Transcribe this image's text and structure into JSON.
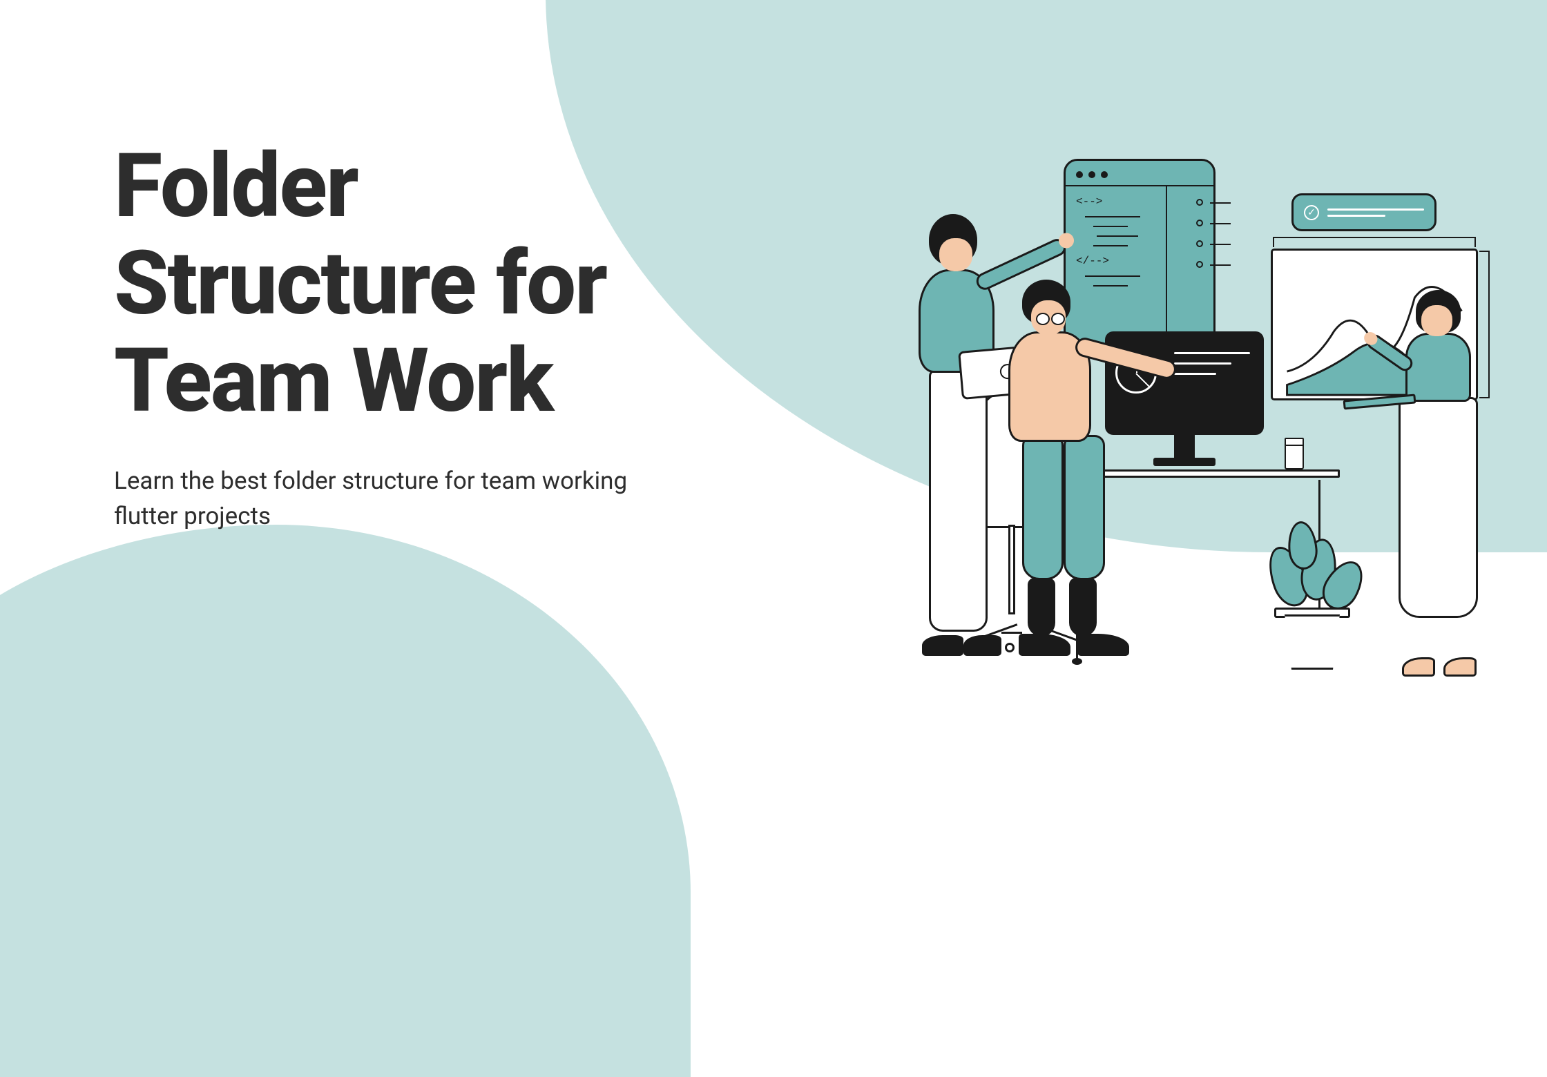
{
  "title": "Folder Structure for Team Work",
  "subtitle": "Learn the best folder structure for team working flutter projects",
  "colors": {
    "background_teal": "#c5e1e0",
    "accent_teal": "#6eb5b3",
    "text_dark": "#2d2d2d",
    "skin": "#f5c9a8",
    "outline": "#1a1a1a"
  },
  "illustration": {
    "description": "Three people working together at a desk with computer screens showing code, charts, and dashboards",
    "elements": [
      "code-editor-panel",
      "notification-badge",
      "line-chart-panel",
      "computer-monitor",
      "pie-chart",
      "desk",
      "office-chair",
      "coffee-cup",
      "potted-plant",
      "person-standing-pointing",
      "person-sitting-typing",
      "person-standing-laptop"
    ]
  }
}
